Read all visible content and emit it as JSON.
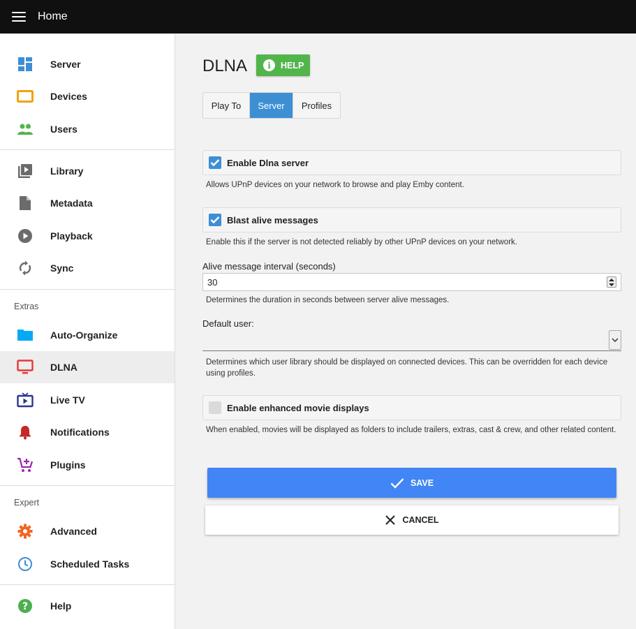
{
  "header": {
    "title": "Home"
  },
  "sidebar": {
    "server_items": [
      {
        "label": "Server",
        "icon": "dashboard-icon",
        "color": "#3d8fd4"
      },
      {
        "label": "Devices",
        "icon": "devices-icon",
        "color": "#f2a30f"
      },
      {
        "label": "Users",
        "icon": "users-icon",
        "color": "#52b54b"
      }
    ],
    "content_items": [
      {
        "label": "Library",
        "icon": "library-icon",
        "color": "#6b6b6b"
      },
      {
        "label": "Metadata",
        "icon": "metadata-icon",
        "color": "#6b6b6b"
      },
      {
        "label": "Playback",
        "icon": "playback-icon",
        "color": "#6b6b6b"
      },
      {
        "label": "Sync",
        "icon": "sync-icon",
        "color": "#6b6b6b"
      }
    ],
    "extras_label": "Extras",
    "extras_items": [
      {
        "label": "Auto-Organize",
        "icon": "folder-icon",
        "color": "#03a9f4"
      },
      {
        "label": "DLNA",
        "icon": "tv-icon",
        "color": "#e53935",
        "active": true
      },
      {
        "label": "Live TV",
        "icon": "live-tv-icon",
        "color": "#283593"
      },
      {
        "label": "Notifications",
        "icon": "bell-icon",
        "color": "#c62828"
      },
      {
        "label": "Plugins",
        "icon": "plugins-icon",
        "color": "#9c27b0"
      }
    ],
    "expert_label": "Expert",
    "expert_items": [
      {
        "label": "Advanced",
        "icon": "gear-icon",
        "color": "#f26522"
      },
      {
        "label": "Scheduled Tasks",
        "icon": "clock-icon",
        "color": "#3d8fd4"
      }
    ],
    "help_item": {
      "label": "Help",
      "icon": "help-icon",
      "color": "#4caf50"
    }
  },
  "main": {
    "title": "DLNA",
    "help_button": "HELP",
    "tabs": [
      {
        "label": "Play To",
        "selected": false
      },
      {
        "label": "Server",
        "selected": true
      },
      {
        "label": "Profiles",
        "selected": false
      }
    ],
    "enable_dlna": {
      "label": "Enable Dlna server",
      "checked": true,
      "description": "Allows UPnP devices on your network to browse and play Emby content."
    },
    "blast_alive": {
      "label": "Blast alive messages",
      "checked": true,
      "description": "Enable this if the server is not detected reliably by other UPnP devices on your network."
    },
    "alive_interval": {
      "label": "Alive message interval (seconds)",
      "value": "30",
      "description": "Determines the duration in seconds between server alive messages."
    },
    "default_user": {
      "label": "Default user:",
      "value": "",
      "description": "Determines which user library should be displayed on connected devices. This can be overridden for each device using profiles."
    },
    "enhanced_movies": {
      "label": "Enable enhanced movie displays",
      "checked": false,
      "description": "When enabled, movies will be displayed as folders to include trailers, extras, cast & crew, and other related content."
    },
    "save_label": "SAVE",
    "cancel_label": "CANCEL"
  },
  "colors": {
    "accent": "#3d8fd4",
    "save": "#4285f4",
    "help": "#52b54b"
  }
}
